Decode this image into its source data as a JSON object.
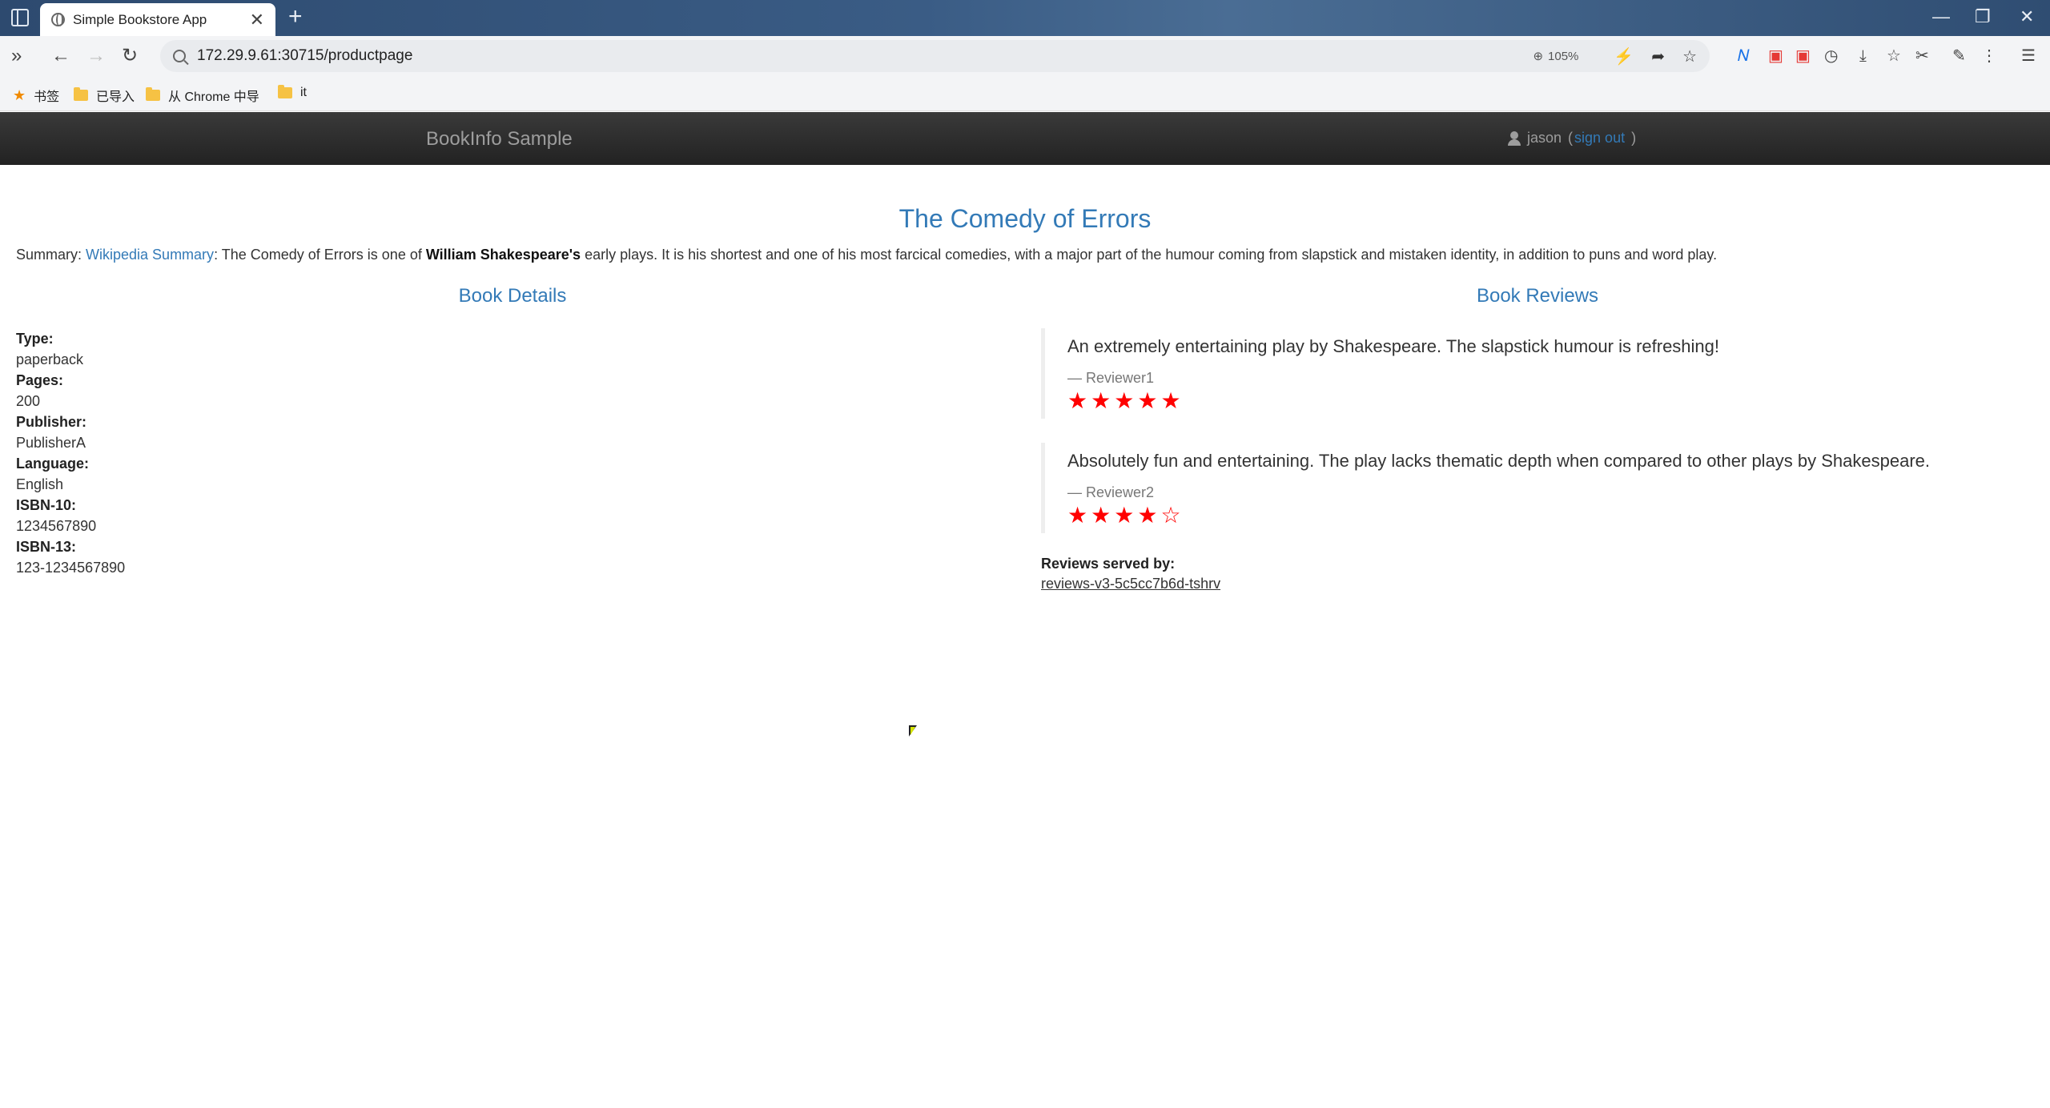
{
  "browser": {
    "tab_title": "Simple Bookstore App",
    "tab_close": "✕",
    "new_tab": "+",
    "url": "172.29.9.61:30715/productpage",
    "zoom": "105%",
    "bookmarks": [
      {
        "label": "书签",
        "icon": "star-icon"
      },
      {
        "label": "已导入",
        "icon": "folder-icon"
      },
      {
        "label": "从 Chrome 中导",
        "icon": "folder-icon"
      },
      {
        "label": "it",
        "icon": "folder-icon"
      }
    ]
  },
  "navbar": {
    "brand": "BookInfo Sample",
    "user": "jason",
    "open_paren": "(",
    "sign_out": "sign out",
    "close_paren": ")"
  },
  "product": {
    "title": "The Comedy of Errors",
    "summary_prefix": "Summary: ",
    "summary_link": "Wikipedia Summary",
    "summary_mid": ": The Comedy of Errors is one of ",
    "summary_bold": "William Shakespeare's",
    "summary_rest": " early plays. It is his shortest and one of his most farcical comedies, with a major part of the humour coming from slapstick and mistaken identity, in addition to puns and word play."
  },
  "details": {
    "heading": "Book Details",
    "fields": [
      {
        "label": "Type:",
        "value": "paperback"
      },
      {
        "label": "Pages:",
        "value": "200"
      },
      {
        "label": "Publisher:",
        "value": "PublisherA"
      },
      {
        "label": "Language:",
        "value": "English"
      },
      {
        "label": "ISBN-10:",
        "value": "1234567890"
      },
      {
        "label": "ISBN-13:",
        "value": "123-1234567890"
      }
    ]
  },
  "reviews": {
    "heading": "Book Reviews",
    "items": [
      {
        "text": "An extremely entertaining play by Shakespeare. The slapstick humour is refreshing!",
        "reviewer": "— Reviewer1",
        "rating": 5
      },
      {
        "text": "Absolutely fun and entertaining. The play lacks thematic depth when compared to other plays by Shakespeare.",
        "reviewer": "— Reviewer2",
        "rating": 4
      }
    ],
    "max_rating": 5,
    "star_color": "#ff0000",
    "served_label": "Reviews served by:",
    "served_value": "reviews-v3-5c5cc7b6d-tshrv"
  },
  "colors": {
    "link": "#337ab7",
    "navbar_bg": "#222222",
    "navbar_text": "#9d9d9d"
  }
}
